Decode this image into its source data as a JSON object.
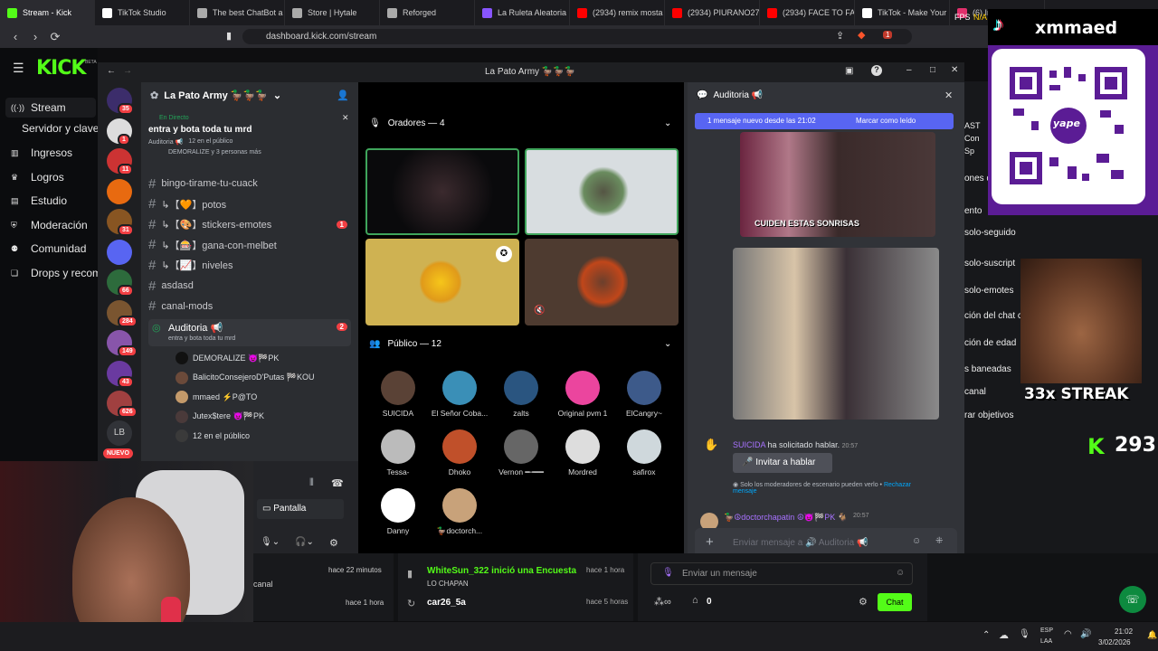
{
  "browser": {
    "tabs": [
      {
        "label": "Stream - Kick",
        "color": "#53fc18"
      },
      {
        "label": "TikTok Studio",
        "color": "#ffffff"
      },
      {
        "label": "The best ChatBot a",
        "color": "#aaaaaa"
      },
      {
        "label": "Store | Hytale",
        "color": "#aaaaaa"
      },
      {
        "label": "Reforged",
        "color": "#aaaaaa"
      },
      {
        "label": "La Ruleta Aleatoria",
        "color": "#8855ff"
      },
      {
        "label": "(2934) remix mosta",
        "color": "#ff0000"
      },
      {
        "label": "(2934) PIURANO27",
        "color": "#ff0000"
      },
      {
        "label": "(2934) FACE TO FAC",
        "color": "#ff0000"
      },
      {
        "label": "TikTok - Make Your",
        "color": "#ffffff"
      },
      {
        "label": "(6) Instag",
        "color": "#e1306c"
      }
    ],
    "url": "dashboard.kick.com/stream",
    "ext_badge": "1"
  },
  "kick": {
    "logo": "KICK",
    "beta": "BETA",
    "nav": [
      {
        "label": "Stream",
        "icon": "stream-icon"
      },
      {
        "label": "Servidor y clave",
        "icon": ""
      },
      {
        "label": "Ingresos",
        "icon": "chart-icon"
      },
      {
        "label": "Logros",
        "icon": "trophy-icon"
      },
      {
        "label": "Estudio",
        "icon": "studio-icon"
      },
      {
        "label": "Moderación",
        "icon": "shield-icon"
      },
      {
        "label": "Comunidad",
        "icon": "people-icon"
      },
      {
        "label": "Drops y recom",
        "icon": "gift-icon"
      }
    ],
    "activity": [
      {
        "title": "",
        "sub": "canal",
        "time": "hace 22 minutos"
      },
      {
        "title": "",
        "sub": "",
        "time": "hace 1 hora"
      },
      {
        "title": "WhiteSun_322 inició una Encuesta",
        "sub": "LO CHAPAN",
        "time": "hace 1 hora"
      },
      {
        "title": "car26_5a",
        "sub": "",
        "time": "hace 5 horas"
      }
    ],
    "chat_placeholder": "Enviar un mensaje",
    "chat_button": "Chat",
    "viewers": "0"
  },
  "discord": {
    "window_title": "La Pato Army 🦆🦆🦆",
    "server_name": "La Pato Army 🦆🦆🦆",
    "live_label": "En Directo",
    "live_title": "entra y bota toda tu mrd",
    "live_channel": "Auditoria 📢",
    "live_count": "12 en el público",
    "live_people": "DEMORALIZE y 3 personas más",
    "server_badges": [
      "35",
      "1",
      "11",
      "",
      "31",
      "",
      "66",
      "284",
      "149",
      "43",
      "626"
    ],
    "server_lb": "LB",
    "server_new": "NUEVO",
    "channels": [
      {
        "name": "bingo-tirame-tu-cuack",
        "badge": ""
      },
      {
        "name": "↳【🧡】potos",
        "badge": ""
      },
      {
        "name": "↳【🎨】stickers-emotes",
        "badge": "1"
      },
      {
        "name": "↳【🎰】gana-con-melbet",
        "badge": ""
      },
      {
        "name": "↳【📈】niveles",
        "badge": ""
      },
      {
        "name": "asdasd",
        "badge": ""
      },
      {
        "name": "canal-mods",
        "badge": ""
      }
    ],
    "voice_channel": {
      "name": "Auditoria 📢",
      "status": "entra y bota toda tu mrd",
      "badge": "2"
    },
    "voice_users": [
      "DEMORALIZE 😈🏁PK",
      "BalicitoConsejeroD'Putas 🏁KOU",
      "mmaed ⚡P@TO",
      "Jutex$tere 😈🏁PK",
      "12 en el público"
    ],
    "screen_label": "Pantalla",
    "speakers_label": "Oradores — 4",
    "public_label": "Público — 12",
    "public": [
      {
        "name": "SUICIDA",
        "color": "#5a4236"
      },
      {
        "name": "El Señor Coba...",
        "color": "#3a8fb7"
      },
      {
        "name": "zalts",
        "color": "#2a5580"
      },
      {
        "name": "Original pvm 1",
        "color": "#eb459e"
      },
      {
        "name": "ElCangry~",
        "color": "#3d5a8a"
      },
      {
        "name": "Tessa-",
        "color": "#bbbbbb"
      },
      {
        "name": "Dhoko",
        "color": "#c0502a"
      },
      {
        "name": "Vernon ━╼━━",
        "color": "#666666"
      },
      {
        "name": "Mordred",
        "color": "#dddddd"
      },
      {
        "name": "safirox",
        "color": "#cfd8dc"
      },
      {
        "name": "Danny",
        "color": "#ffffff"
      },
      {
        "name": "🦆doctorch...",
        "color": "#c8a27a"
      }
    ],
    "chat_title": "Auditoria 📢",
    "new_msgs": "1 mensaje nuevo desde las 21:02",
    "mark_read": "Marcar como leído",
    "caption1": "CUIDEN ESTAS SONRISAS",
    "request_user": "SUICIDA",
    "request_text": "ha solicitado hablar.",
    "request_time": "20:57",
    "invite_btn": "Invitar a hablar",
    "mods_note": "Solo los moderadores de escenario pueden verlo •",
    "reject": "Rechazar",
    "reject2": "mensaje",
    "last_user": "🦆☮doctorchapatin ☮😈🏁PK 🐐",
    "last_time": "20:57",
    "input_placeholder": "Enviar mensaje a 🔊 Auditoria 📢"
  },
  "overlay": {
    "tiktok_handle": "xmmaed",
    "qr_brand": "yape",
    "streak": "33x STREAK",
    "kick_count": "293"
  },
  "right_panel": {
    "items": [
      {
        "label": "ones de canal"
      },
      {
        "label": "ento"
      },
      {
        "label": "solo-seguido"
      },
      {
        "label": "solo-suscript"
      },
      {
        "label": "solo-emotes"
      },
      {
        "label": "ción del chat co"
      },
      {
        "label": "ción de edad"
      },
      {
        "label": "s baneadas"
      },
      {
        "label": "canal"
      },
      {
        "label": "rar objetivos"
      }
    ],
    "top_labels": [
      "AST",
      "Con",
      "Sp"
    ],
    "fps": "FPS",
    "fps_val": "N/A",
    "net": "A N/A"
  },
  "taskbar": {
    "lang1": "ESP",
    "lang2": "LAA",
    "time": "21:02",
    "date": "3/02/2026"
  }
}
